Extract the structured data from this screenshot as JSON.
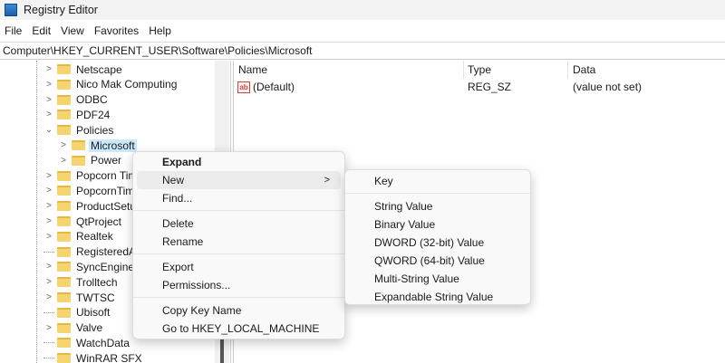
{
  "window": {
    "title": "Registry Editor"
  },
  "menubar": [
    "File",
    "Edit",
    "View",
    "Favorites",
    "Help"
  ],
  "address": "Computer\\HKEY_CURRENT_USER\\Software\\Policies\\Microsoft",
  "tree": [
    {
      "label": "Netscape",
      "exp": ">"
    },
    {
      "label": "Nico Mak Computing",
      "exp": ">"
    },
    {
      "label": "ODBC",
      "exp": ">"
    },
    {
      "label": "PDF24",
      "exp": ">"
    },
    {
      "label": "Policies",
      "exp": "v"
    },
    {
      "label": "Microsoft",
      "exp": ">",
      "child": true,
      "selected": true
    },
    {
      "label": "Power",
      "exp": ">",
      "child": true
    },
    {
      "label": "Popcorn Tim",
      "exp": ">"
    },
    {
      "label": "PopcornTime",
      "exp": ">"
    },
    {
      "label": "ProductSetu",
      "exp": ">"
    },
    {
      "label": "QtProject",
      "exp": ">"
    },
    {
      "label": "Realtek",
      "exp": ">"
    },
    {
      "label": "RegisteredA",
      "exp": ""
    },
    {
      "label": "SyncEngines",
      "exp": ">"
    },
    {
      "label": "Trolltech",
      "exp": ">"
    },
    {
      "label": "TWTSC",
      "exp": ">"
    },
    {
      "label": "Ubisoft",
      "exp": ""
    },
    {
      "label": "Valve",
      "exp": ">"
    },
    {
      "label": "WatchData",
      "exp": ""
    },
    {
      "label": "WinRAR SFX",
      "exp": ""
    }
  ],
  "columns": {
    "name": "Name",
    "type": "Type",
    "data": "Data"
  },
  "values": [
    {
      "icon": "ab",
      "name": "(Default)",
      "type": "REG_SZ",
      "data": "(value not set)"
    }
  ],
  "context_menu": {
    "expand": "Expand",
    "new": "New",
    "new_arrow": ">",
    "find": "Find...",
    "delete": "Delete",
    "rename": "Rename",
    "export": "Export",
    "permissions": "Permissions...",
    "copy_key_name": "Copy Key Name",
    "goto": "Go to HKEY_LOCAL_MACHINE"
  },
  "submenu": {
    "key": "Key",
    "string": "String Value",
    "binary": "Binary Value",
    "dword": "DWORD (32-bit) Value",
    "qword": "QWORD (64-bit) Value",
    "multi": "Multi-String Value",
    "expandable": "Expandable String Value"
  }
}
